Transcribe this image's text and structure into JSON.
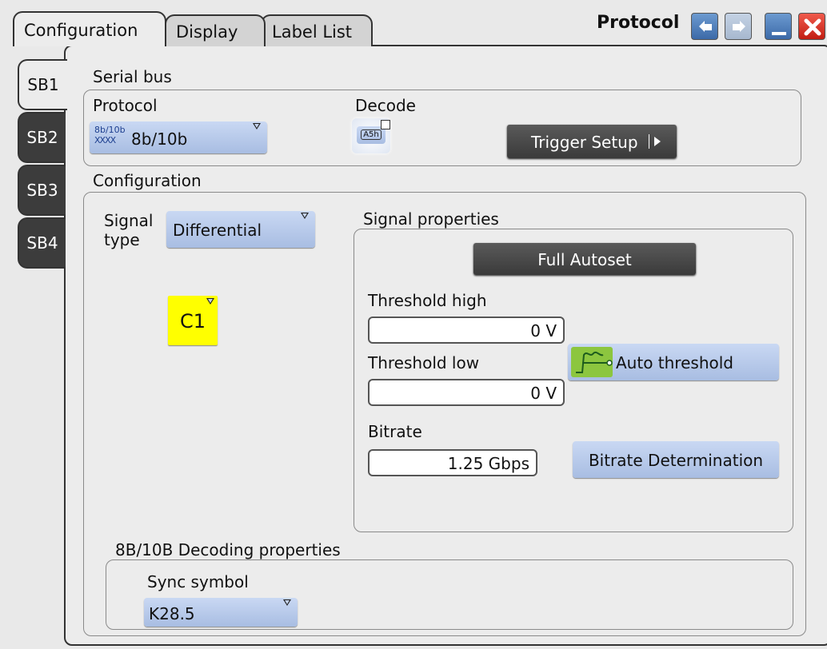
{
  "tabs": [
    {
      "label": "Configuration"
    },
    {
      "label": "Display"
    },
    {
      "label": "Label List"
    }
  ],
  "window_title": "Protocol",
  "serial_buses": [
    "SB1",
    "SB2",
    "SB3",
    "SB4"
  ],
  "serial_bus": {
    "label": "Serial bus",
    "protocol_label": "Protocol",
    "protocol_icon_text_top": "8b/10b",
    "protocol_icon_text_bottom": "XXXX",
    "protocol_value": "8b/10b",
    "decode_label": "Decode",
    "decode_icon_text": "A5h",
    "trigger_setup_label": "Trigger Setup"
  },
  "configuration": {
    "label": "Configuration",
    "signal_type_label_line1": "Signal",
    "signal_type_label_line2": "type",
    "signal_type_value": "Differential",
    "channel": "C1",
    "channel_color": "#ffff00"
  },
  "signal_properties": {
    "label": "Signal properties",
    "full_autoset_label": "Full Autoset",
    "threshold_high_label": "Threshold high",
    "threshold_high_value": "0 V",
    "threshold_low_label": "Threshold low",
    "threshold_low_value": "0 V",
    "auto_threshold_label": "Auto threshold",
    "bitrate_label": "Bitrate",
    "bitrate_value": "1.25 Gbps",
    "bitrate_determination_label": "Bitrate Determination"
  },
  "decoding_properties": {
    "label": "8B/10B Decoding properties",
    "sync_symbol_label": "Sync symbol",
    "sync_symbol_value": "K28.5"
  },
  "colors": {
    "accent_blue": "#a8bde2",
    "dark_button": "#3a3a3a",
    "close_red": "#d42a1d",
    "auto_threshold_icon": "#8cc63f"
  },
  "icons": {
    "undo": "undo-arrow",
    "redo": "redo-arrow",
    "minimize": "minimize",
    "close": "close-x"
  }
}
